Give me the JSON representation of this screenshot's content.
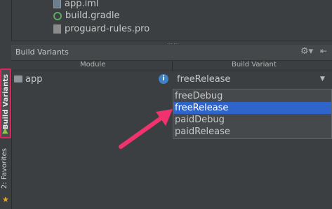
{
  "project_tree": {
    "items": [
      {
        "label": "app.iml",
        "icon": "iml-file-icon"
      },
      {
        "label": "build.gradle",
        "icon": "gradle-file-icon"
      },
      {
        "label": "proguard-rules.pro",
        "icon": "text-file-icon"
      }
    ]
  },
  "sidebar": {
    "build_variants_tab": "Build Variants",
    "favorites_tab": "2: Favorites"
  },
  "panel": {
    "title": "Build Variants",
    "columns": {
      "module": "Module",
      "variant": "Build Variant"
    },
    "row": {
      "module": "app",
      "variant": "freeRelease"
    }
  },
  "dropdown": {
    "options": [
      "freeDebug",
      "freeRelease",
      "paidDebug",
      "paidRelease"
    ],
    "selected": "freeRelease"
  },
  "colors": {
    "highlight_border": "#e0245e",
    "arrow": "#f0336f",
    "selection": "#2f65ca"
  }
}
